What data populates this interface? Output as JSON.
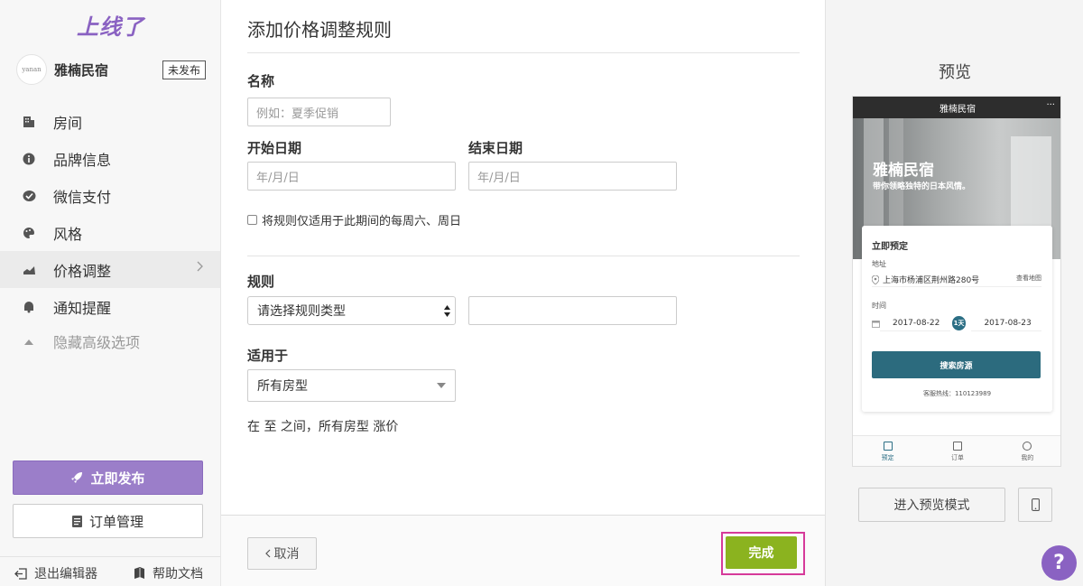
{
  "brand": {
    "logo_text": "上线了",
    "accent": "#8a62c2"
  },
  "hotel": {
    "avatar_text": "yanan",
    "name": "雅楠民宿",
    "status_badge": "未发布"
  },
  "sidebar": {
    "items": [
      {
        "label": "房间",
        "icon": "building-icon"
      },
      {
        "label": "品牌信息",
        "icon": "info-icon"
      },
      {
        "label": "微信支付",
        "icon": "wechat-pay-icon"
      },
      {
        "label": "风格",
        "icon": "palette-icon"
      },
      {
        "label": "价格调整",
        "icon": "chart-icon",
        "active": true
      },
      {
        "label": "通知提醒",
        "icon": "bell-icon"
      },
      {
        "label": "隐藏高级选项",
        "icon": "caret-up-icon",
        "muted": true
      }
    ],
    "publish_label": "立即发布",
    "orders_label": "订单管理",
    "exit_label": "退出编辑器",
    "help_label": "帮助文档"
  },
  "form": {
    "title": "添加价格调整规则",
    "name_label": "名称",
    "name_placeholder": "例如：夏季促销",
    "start_label": "开始日期",
    "start_placeholder": "年/月/日",
    "end_label": "结束日期",
    "end_placeholder": "年/月/日",
    "weekend_checkbox_label": "将规则仅适用于此期间的每周六、周日",
    "rule_label": "规则",
    "rule_select_value": "请选择规则类型",
    "rule_value": "",
    "applies_label": "适用于",
    "applies_value": "所有房型",
    "summary": "在 至 之间，所有房型 涨价",
    "cancel_label": "取消",
    "done_label": "完成"
  },
  "preview": {
    "title": "预览",
    "phone_title": "雅楠民宿",
    "more": "···",
    "hero_title": "雅楠民宿",
    "hero_subtitle": "带你领略独特的日本风情。",
    "book_title": "立即预定",
    "address_label": "地址",
    "address": "上海市杨浦区荆州路280号",
    "map_link": "查看地图",
    "time_label": "时间",
    "checkin": "2017-08-22",
    "nights": "1天",
    "checkout": "2017-08-23",
    "search_label": "搜索房源",
    "hotline": "客服热线：110123989",
    "tabs": [
      "预定",
      "订单",
      "我的"
    ],
    "enter_preview_label": "进入预览模式",
    "help_fab": "?"
  }
}
